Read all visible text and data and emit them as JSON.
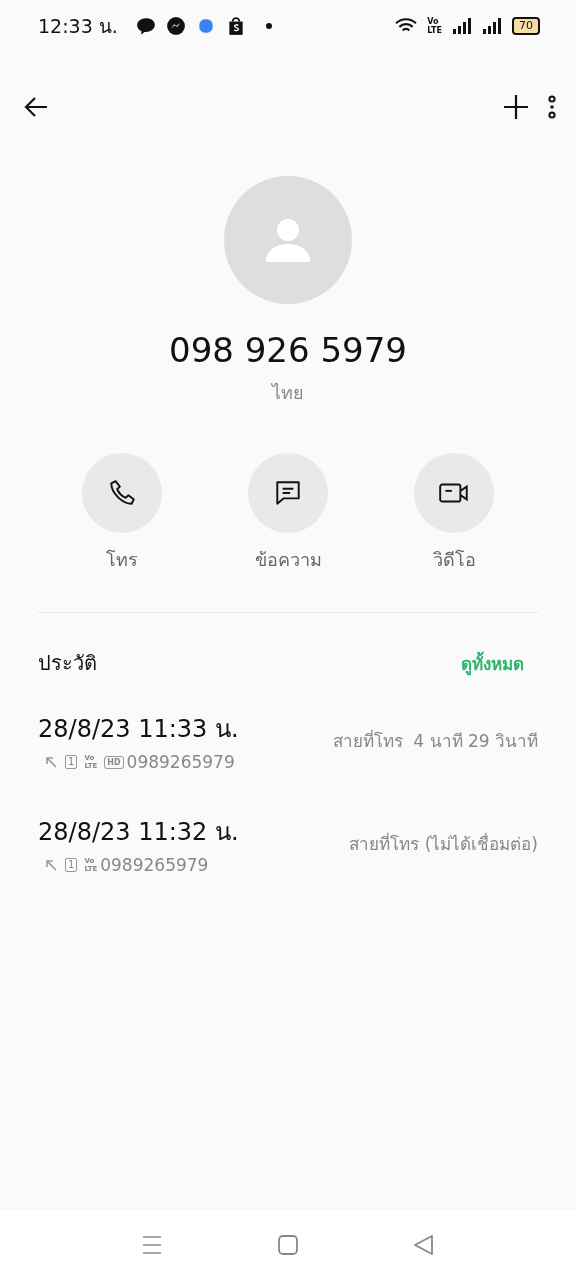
{
  "status_bar": {
    "time": "12:33 น.",
    "volte": [
      "Vo",
      "LTE"
    ],
    "battery": "70"
  },
  "contact": {
    "number": "098 926 5979",
    "location": "ไทย"
  },
  "actions": [
    {
      "kind": "call",
      "label": "โทร"
    },
    {
      "kind": "message",
      "label": "ข้อความ"
    },
    {
      "kind": "video",
      "label": "วิดีโอ"
    }
  ],
  "history": {
    "title": "ประวัติ",
    "see_all": "ดูทั้งหมด",
    "entries": [
      {
        "time": "28/8/23 11:33 น.",
        "kind": "outgoing",
        "sim": "1",
        "volte": [
          "Vo",
          "LTE"
        ],
        "hd": "HD",
        "number": "0989265979",
        "detail": "สายที่โทร  4 นาที 29 วินาที"
      },
      {
        "time": "28/8/23 11:32 น.",
        "kind": "outgoing",
        "sim": "1",
        "volte": [
          "Vo",
          "LTE"
        ],
        "number": "0989265979",
        "detail": "สายที่โทร (ไม่ได้เชื่อมต่อ)"
      }
    ]
  }
}
